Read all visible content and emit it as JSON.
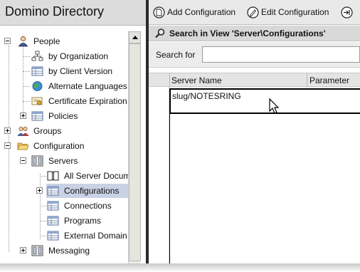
{
  "left_pane": {
    "title": "Domino Directory",
    "tree": [
      {
        "label": "People",
        "icon": "person-icon",
        "expander": "minus"
      },
      {
        "label": "by Organization",
        "icon": "org-chart-icon"
      },
      {
        "label": "by Client Version",
        "icon": "view-icon"
      },
      {
        "label": "Alternate Languages",
        "icon": "globe-icon"
      },
      {
        "label": "Certificate Expiration",
        "icon": "certificate-icon"
      },
      {
        "label": "Policies",
        "icon": "view-icon",
        "expander": "plus"
      },
      {
        "label": "Groups",
        "icon": "group-icon",
        "expander": "plus"
      },
      {
        "label": "Configuration",
        "icon": "open-folder-icon",
        "expander": "minus"
      },
      {
        "label": "Servers",
        "icon": "server-icon",
        "expander": "minus"
      },
      {
        "label": "All Server Docum",
        "icon": "book-icon"
      },
      {
        "label": "Configurations",
        "icon": "view-icon",
        "expander": "plus",
        "selected": true
      },
      {
        "label": "Connections",
        "icon": "view-icon"
      },
      {
        "label": "Programs",
        "icon": "view-icon"
      },
      {
        "label": "External Domain",
        "icon": "view-icon"
      },
      {
        "label": "Messaging",
        "icon": "messaging-icon",
        "expander": "plus"
      }
    ]
  },
  "toolbar": {
    "add_label": "Add Configuration",
    "edit_label": "Edit Configuration"
  },
  "search": {
    "header": "Search in View 'Server\\Configurations'",
    "label": "Search for",
    "value": "",
    "placeholder": ""
  },
  "grid": {
    "columns": [
      "Server Name",
      "Parameter"
    ],
    "rows": [
      {
        "server_name": "slug/NOTESRING"
      }
    ]
  },
  "colors": {
    "selection": "#c9d2e4",
    "title_bar": "#dcdcdc",
    "splitter": "#2a2a2a"
  }
}
